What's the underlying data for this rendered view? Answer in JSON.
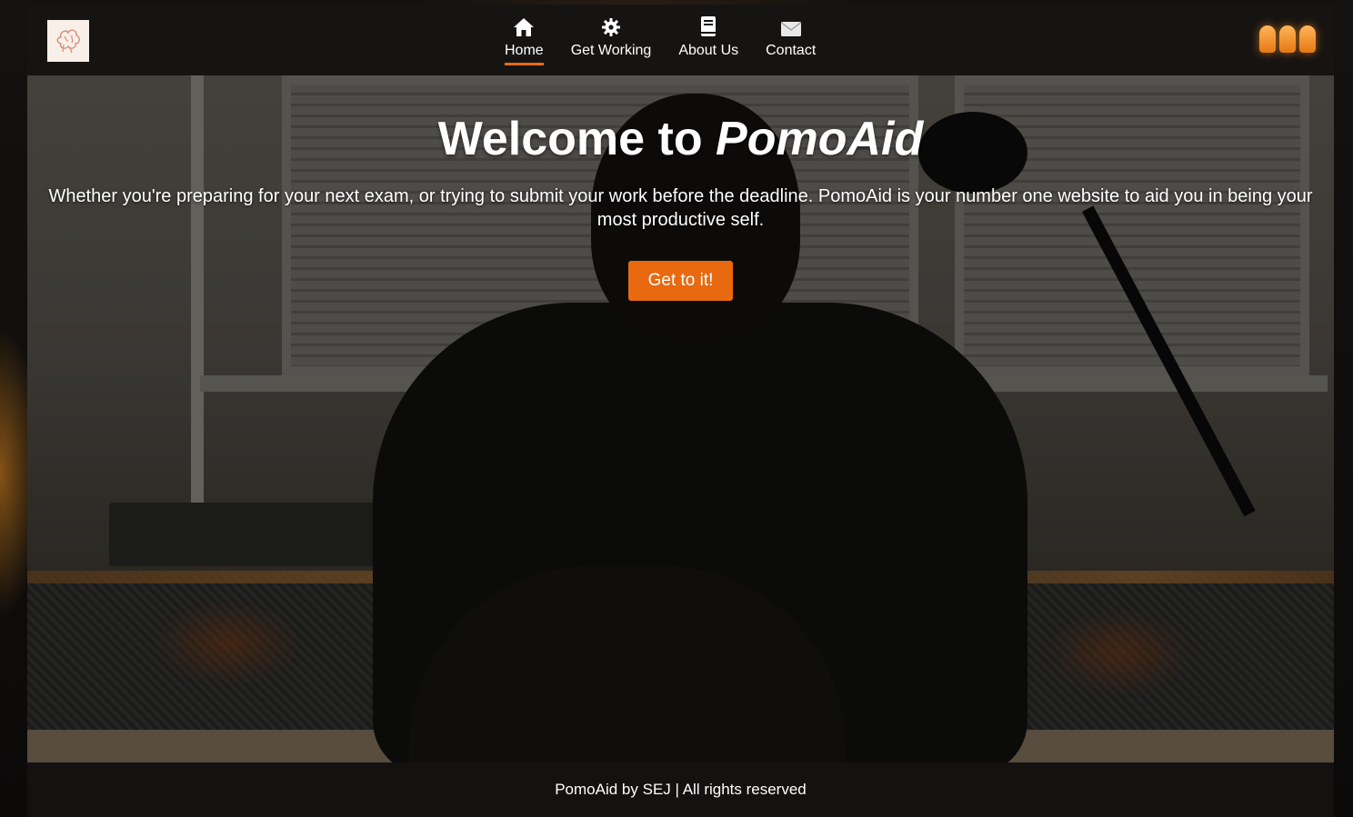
{
  "nav": {
    "items": [
      {
        "label": "Home",
        "icon": "home-icon",
        "active": true
      },
      {
        "label": "Get Working",
        "icon": "gear-icon",
        "active": false
      },
      {
        "label": "About Us",
        "icon": "book-icon",
        "active": false
      },
      {
        "label": "Contact",
        "icon": "envelope-icon",
        "active": false
      }
    ],
    "logo_icon": "brain-logo-icon",
    "menu_icon": "hamburger-menu-icon"
  },
  "hero": {
    "title_prefix": "Welcome to ",
    "title_brand": "PomoAid",
    "subtitle": "Whether you're preparing for your next exam, or trying to submit your work before the deadline. PomoAid is your number one website to aid you in being your most productive self.",
    "cta_label": "Get to it!"
  },
  "footer": {
    "text": "PomoAid by SEJ | All rights reserved"
  },
  "colors": {
    "accent": "#e8690f",
    "navbar_bg": "#161412",
    "text": "#ffffff"
  }
}
